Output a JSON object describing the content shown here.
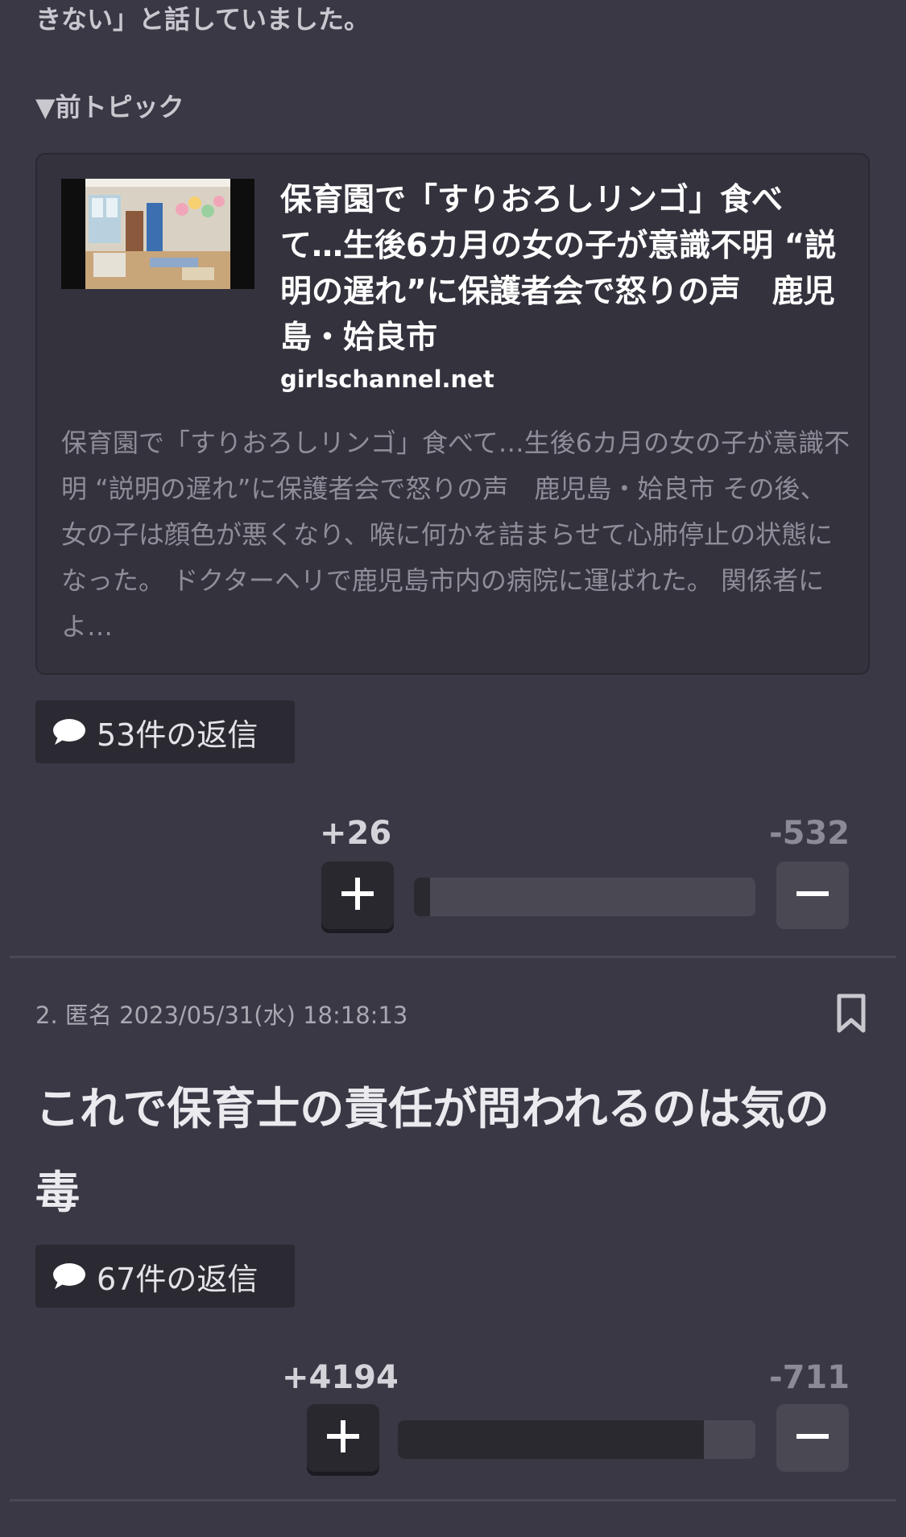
{
  "top_text": "きない」と話していました。",
  "prev_topic_label": "▼前トピック",
  "card": {
    "title": "保育園で「すりおろしリンゴ」食べて…生後6カ月の女の子が意識不明 “説明の遅れ”に保護者会で怒りの声　鹿児島・姶良市",
    "domain": "girlschannel.net",
    "description": "保育園で「すりおろしリンゴ」食べて…生後6カ月の女の子が意識不明 “説明の遅れ”に保護者会で怒りの声　鹿児島・姶良市 その後、女の子は顔色が悪くなり、喉に何かを詰まらせて心肺停止の状態になった。 ドクターヘリで鹿児島市内の病院に運ばれた。 関係者によ…"
  },
  "comment1": {
    "replies_label": "53件の返信",
    "plus_count": "+26",
    "minus_count": "-532",
    "plus_ratio": 0.047
  },
  "comment2": {
    "meta": "2. 匿名 2023/05/31(水) 18:18:13",
    "body": "これで保育士の責任が問われるのは気の毒",
    "replies_label": "67件の返信",
    "plus_count": "+4194",
    "minus_count": "-711",
    "plus_ratio": 0.855
  },
  "icons": {
    "reply": "speech-bubble-icon",
    "plus": "plus-icon",
    "minus": "minus-icon",
    "bookmark": "bookmark-icon"
  }
}
